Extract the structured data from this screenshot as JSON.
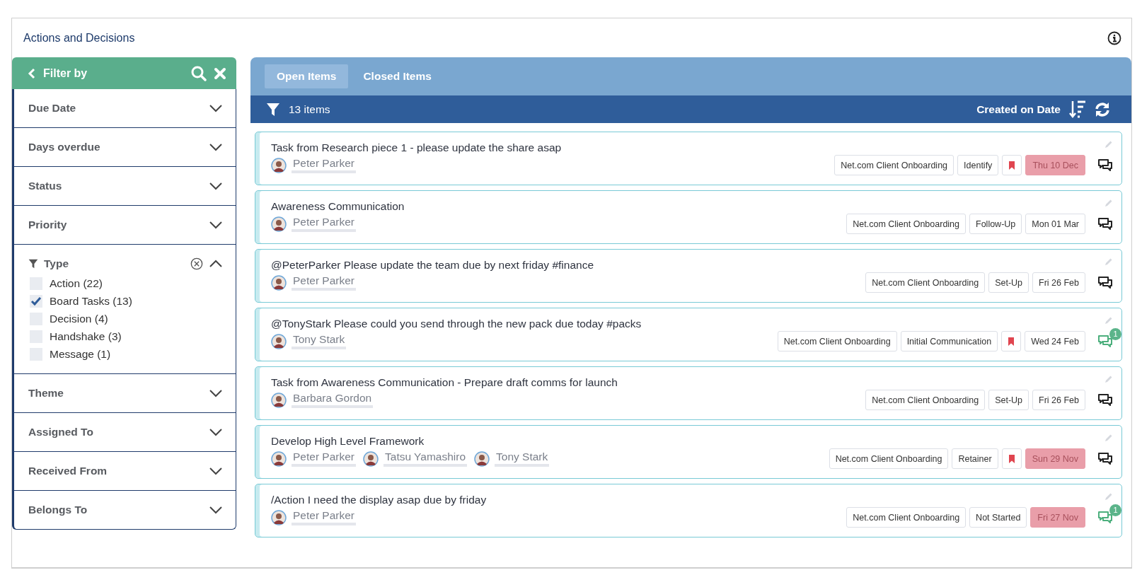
{
  "panel": {
    "title": "Actions and Decisions"
  },
  "filter": {
    "title": "Filter by",
    "sections": [
      {
        "label": "Due Date",
        "expanded": false,
        "active": false
      },
      {
        "label": "Days overdue",
        "expanded": false,
        "active": false
      },
      {
        "label": "Status",
        "expanded": false,
        "active": false
      },
      {
        "label": "Priority",
        "expanded": false,
        "active": false
      },
      {
        "label": "Type",
        "expanded": true,
        "active": true,
        "options": [
          {
            "label": "Action (22)",
            "checked": false
          },
          {
            "label": "Board Tasks (13)",
            "checked": true
          },
          {
            "label": "Decision (4)",
            "checked": false
          },
          {
            "label": "Handshake (3)",
            "checked": false
          },
          {
            "label": "Message (1)",
            "checked": false
          }
        ]
      },
      {
        "label": "Theme",
        "expanded": false,
        "active": false
      },
      {
        "label": "Assigned To",
        "expanded": false,
        "active": false
      },
      {
        "label": "Received From",
        "expanded": false,
        "active": false
      },
      {
        "label": "Belongs To",
        "expanded": false,
        "active": false
      }
    ]
  },
  "tabs": [
    {
      "label": "Open Items",
      "selected": true
    },
    {
      "label": "Closed Items",
      "selected": false
    }
  ],
  "toolbar": {
    "count": "13 items",
    "sort": "Created on Date"
  },
  "items": [
    {
      "title": "Task from Research piece 1 - please update the share asap",
      "assignees": [
        "Peter Parker"
      ],
      "tags": [
        "Net.com Client Onboarding",
        "Identify"
      ],
      "flagged": true,
      "due": "Thu 10 Dec",
      "overdue": true
    },
    {
      "title": "Awareness Communication",
      "assignees": [
        "Peter Parker"
      ],
      "tags": [
        "Net.com Client Onboarding",
        "Follow-Up"
      ],
      "flagged": false,
      "due": "Mon 01 Mar",
      "overdue": false
    },
    {
      "title": "@PeterParker Please update the team due by next friday #finance",
      "assignees": [
        "Peter Parker"
      ],
      "tags": [
        "Net.com Client Onboarding",
        "Set-Up"
      ],
      "flagged": false,
      "due": "Fri 26 Feb",
      "overdue": false
    },
    {
      "title": "@TonyStark Please could you send through the new pack due today #packs",
      "assignees": [
        "Tony Stark"
      ],
      "tags": [
        "Net.com Client Onboarding",
        "Initial Communication"
      ],
      "flagged": true,
      "due": "Wed 24 Feb",
      "overdue": false,
      "comments": "1"
    },
    {
      "title": "Task from Awareness Communication - Prepare draft comms for launch",
      "assignees": [
        "Barbara Gordon"
      ],
      "tags": [
        "Net.com Client Onboarding",
        "Set-Up"
      ],
      "flagged": false,
      "due": "Fri 26 Feb",
      "overdue": false
    },
    {
      "title": "Develop High Level Framework",
      "assignees": [
        "Peter Parker",
        "Tatsu Yamashiro",
        "Tony Stark"
      ],
      "tags": [
        "Net.com Client Onboarding",
        "Retainer"
      ],
      "flagged": true,
      "due": "Sun 29 Nov",
      "overdue": true
    },
    {
      "title": "/Action I need the display asap due by friday",
      "assignees": [
        "Peter Parker"
      ],
      "tags": [
        "Net.com Client Onboarding",
        "Not Started"
      ],
      "flagged": false,
      "due": "Fri 27 Nov",
      "overdue": true,
      "comments": "1"
    }
  ]
}
